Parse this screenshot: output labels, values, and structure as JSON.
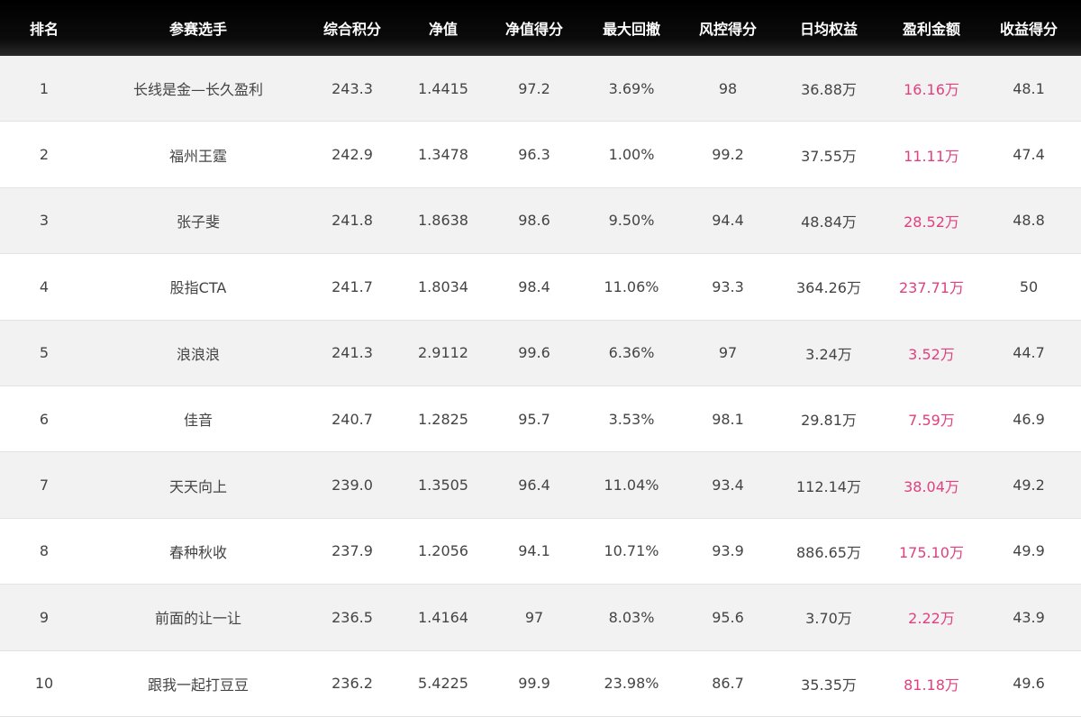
{
  "headers": {
    "rank": "排名",
    "player": "参赛选手",
    "total_score": "综合积分",
    "nav": "净值",
    "nav_score": "净值得分",
    "max_drawdown": "最大回撤",
    "risk_score": "风控得分",
    "daily_equity": "日均权益",
    "profit": "盈利金额",
    "return_score": "收益得分"
  },
  "rows": [
    {
      "rank": "1",
      "player": "长线是金—长久盈利",
      "total_score": "243.3",
      "nav": "1.4415",
      "nav_score": "97.2",
      "max_drawdown": "3.69%",
      "risk_score": "98",
      "daily_equity": "36.88万",
      "profit": "16.16万",
      "return_score": "48.1"
    },
    {
      "rank": "2",
      "player": "福州王霆",
      "total_score": "242.9",
      "nav": "1.3478",
      "nav_score": "96.3",
      "max_drawdown": "1.00%",
      "risk_score": "99.2",
      "daily_equity": "37.55万",
      "profit": "11.11万",
      "return_score": "47.4"
    },
    {
      "rank": "3",
      "player": "张子斐",
      "total_score": "241.8",
      "nav": "1.8638",
      "nav_score": "98.6",
      "max_drawdown": "9.50%",
      "risk_score": "94.4",
      "daily_equity": "48.84万",
      "profit": "28.52万",
      "return_score": "48.8"
    },
    {
      "rank": "4",
      "player": "股指CTA",
      "total_score": "241.7",
      "nav": "1.8034",
      "nav_score": "98.4",
      "max_drawdown": "11.06%",
      "risk_score": "93.3",
      "daily_equity": "364.26万",
      "profit": "237.71万",
      "return_score": "50"
    },
    {
      "rank": "5",
      "player": "浪浪浪",
      "total_score": "241.3",
      "nav": "2.9112",
      "nav_score": "99.6",
      "max_drawdown": "6.36%",
      "risk_score": "97",
      "daily_equity": "3.24万",
      "profit": "3.52万",
      "return_score": "44.7"
    },
    {
      "rank": "6",
      "player": "佳音",
      "total_score": "240.7",
      "nav": "1.2825",
      "nav_score": "95.7",
      "max_drawdown": "3.53%",
      "risk_score": "98.1",
      "daily_equity": "29.81万",
      "profit": "7.59万",
      "return_score": "46.9"
    },
    {
      "rank": "7",
      "player": "天天向上",
      "total_score": "239.0",
      "nav": "1.3505",
      "nav_score": "96.4",
      "max_drawdown": "11.04%",
      "risk_score": "93.4",
      "daily_equity": "112.14万",
      "profit": "38.04万",
      "return_score": "49.2"
    },
    {
      "rank": "8",
      "player": "春种秋收",
      "total_score": "237.9",
      "nav": "1.2056",
      "nav_score": "94.1",
      "max_drawdown": "10.71%",
      "risk_score": "93.9",
      "daily_equity": "886.65万",
      "profit": "175.10万",
      "return_score": "49.9"
    },
    {
      "rank": "9",
      "player": "前面的让一让",
      "total_score": "236.5",
      "nav": "1.4164",
      "nav_score": "97",
      "max_drawdown": "8.03%",
      "risk_score": "95.6",
      "daily_equity": "3.70万",
      "profit": "2.22万",
      "return_score": "43.9"
    },
    {
      "rank": "10",
      "player": "跟我一起打豆豆",
      "total_score": "236.2",
      "nav": "5.4225",
      "nav_score": "99.9",
      "max_drawdown": "23.98%",
      "risk_score": "86.7",
      "daily_equity": "35.35万",
      "profit": "81.18万",
      "return_score": "49.6"
    }
  ],
  "colors": {
    "header_bg": "#000000",
    "header_text": "#ffffff",
    "row_alt_bg": "#f2f2f2",
    "text": "#444444",
    "profit_text": "#e0407f"
  }
}
